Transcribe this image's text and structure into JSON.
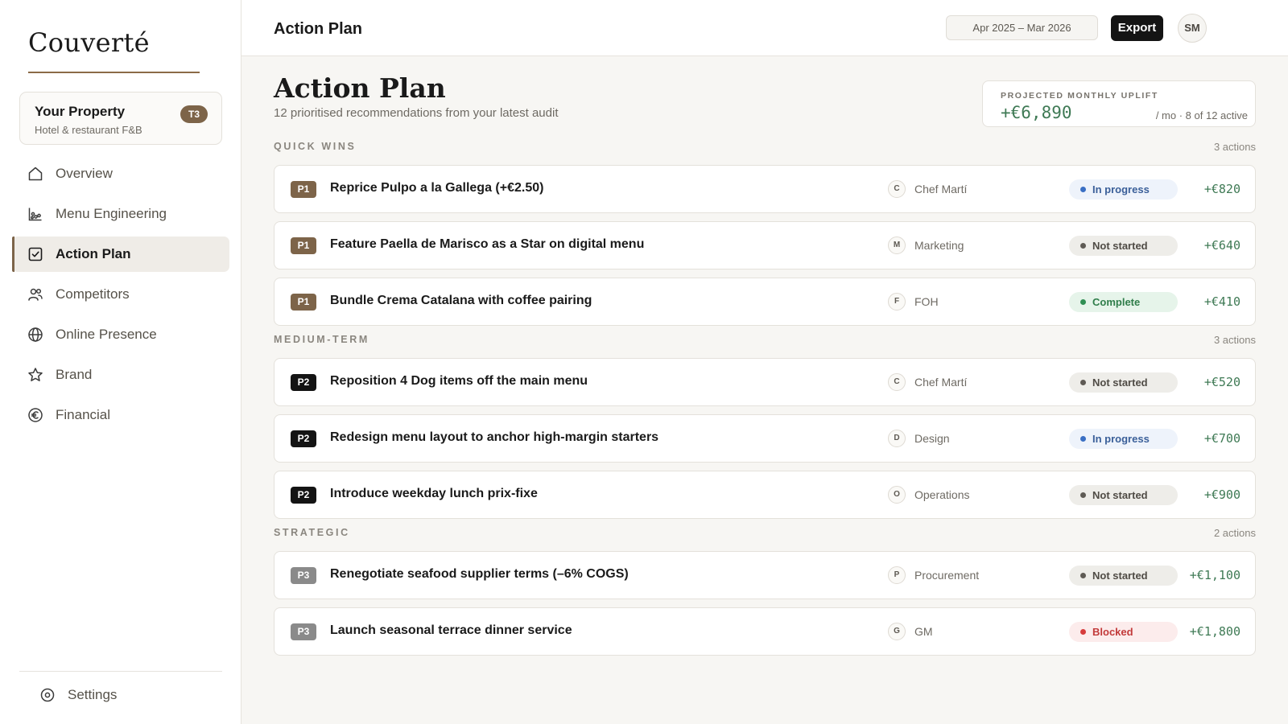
{
  "brand": {
    "name": "Couverté"
  },
  "property": {
    "name": "Your Property",
    "subtitle": "Hotel & restaurant F&B",
    "tier": "T3"
  },
  "nav": {
    "items": [
      {
        "label": "Overview",
        "icon": "home-icon"
      },
      {
        "label": "Menu Engineering",
        "icon": "chart-icon"
      },
      {
        "label": "Action Plan",
        "icon": "checkbox-icon",
        "active": true
      },
      {
        "label": "Competitors",
        "icon": "users-icon"
      },
      {
        "label": "Online Presence",
        "icon": "globe-icon"
      },
      {
        "label": "Brand",
        "icon": "star-icon"
      },
      {
        "label": "Financial",
        "icon": "euro-icon"
      }
    ],
    "settings": {
      "label": "Settings",
      "icon": "settings-icon"
    }
  },
  "header": {
    "title": "Action Plan",
    "date_range": "Apr 2025 – Mar 2026",
    "export_label": "Export",
    "avatar": "SM"
  },
  "page": {
    "title": "Action Plan",
    "subtitle": "12 prioritised recommendations from your latest audit"
  },
  "uplift": {
    "label": "PROJECTED MONTHLY UPLIFT",
    "value": "+€6,890",
    "meta": "/ mo · 8 of 12 active"
  },
  "sections": [
    {
      "name": "QUICK WINS",
      "count": "3 actions",
      "actions": [
        {
          "priority": "P1",
          "title": "Reprice Pulpo a la Gallega (+€2.50)",
          "owner_initial": "C",
          "owner": "Chef Martí",
          "status": "In progress",
          "status_kind": "progress",
          "amount": "+€820"
        },
        {
          "priority": "P1",
          "title": "Feature Paella de Marisco as a Star on digital menu",
          "owner_initial": "M",
          "owner": "Marketing",
          "status": "Not started",
          "status_kind": "notstarted",
          "amount": "+€640"
        },
        {
          "priority": "P1",
          "title": "Bundle Crema Catalana with coffee pairing",
          "owner_initial": "F",
          "owner": "FOH",
          "status": "Complete",
          "status_kind": "complete",
          "amount": "+€410"
        }
      ]
    },
    {
      "name": "MEDIUM-TERM",
      "count": "3 actions",
      "actions": [
        {
          "priority": "P2",
          "title": "Reposition 4 Dog items off the main menu",
          "owner_initial": "C",
          "owner": "Chef Martí",
          "status": "Not started",
          "status_kind": "notstarted",
          "amount": "+€520"
        },
        {
          "priority": "P2",
          "title": "Redesign menu layout to anchor high-margin starters",
          "owner_initial": "D",
          "owner": "Design",
          "status": "In progress",
          "status_kind": "progress",
          "amount": "+€700"
        },
        {
          "priority": "P2",
          "title": "Introduce weekday lunch prix-fixe",
          "owner_initial": "O",
          "owner": "Operations",
          "status": "Not started",
          "status_kind": "notstarted",
          "amount": "+€900"
        }
      ]
    },
    {
      "name": "STRATEGIC",
      "count": "2 actions",
      "actions": [
        {
          "priority": "P3",
          "title": "Renegotiate seafood supplier terms (–6% COGS)",
          "owner_initial": "P",
          "owner": "Procurement",
          "status": "Not started",
          "status_kind": "notstarted",
          "amount": "+€1,100"
        },
        {
          "priority": "P3",
          "title": "Launch seasonal terrace dinner service",
          "owner_initial": "G",
          "owner": "GM",
          "status": "Blocked",
          "status_kind": "blocked",
          "amount": "+€1,800"
        }
      ]
    }
  ],
  "colors": {
    "accent": "#7d6449",
    "p1": "#7d6449",
    "p2": "#141414",
    "p3": "#8a8a8a",
    "positive": "#3f7a55"
  }
}
